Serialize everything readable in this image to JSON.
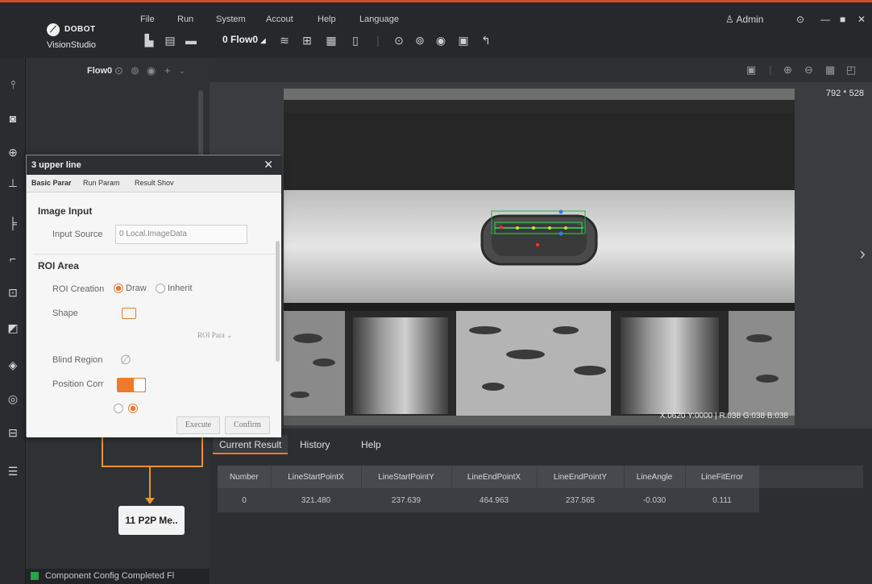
{
  "brand": {
    "logo": "DOBOT",
    "app_name": "VisionStudio"
  },
  "menu": [
    "File",
    "Run",
    "System",
    "Accout",
    "Help",
    "Language"
  ],
  "user": {
    "name": "Admin"
  },
  "toolbar": {
    "flow_select": "0 Flow0"
  },
  "flow_panel": {
    "title": "Flow0",
    "node_label": "11 P2P Me..",
    "status": "Component Config Completed Fl"
  },
  "viewer": {
    "image_size": "792 * 528",
    "pixel_info": "X:0620 Y:0000 | R:038 G:038 B:038"
  },
  "results": {
    "tabs": [
      "Current Result",
      "History",
      "Help"
    ],
    "columns": [
      "Number",
      "LineStartPointX",
      "LineStartPointY",
      "LineEndPointX",
      "LineEndPointY",
      "LineAngle",
      "LineFitError"
    ],
    "rows": [
      [
        "0",
        "321.480",
        "237.639",
        "464.963",
        "237.565",
        "-0.030",
        "0.111"
      ]
    ]
  },
  "dialog": {
    "title": "3 upper line",
    "tabs": [
      "Basic Parar",
      "Run Param",
      "Result Shov"
    ],
    "image_input_title": "Image Input",
    "input_source_label": "Input Source",
    "input_source_value": "0 Local.ImageData",
    "roi_area_title": "ROI Area",
    "roi_creation_label": "ROI Creation",
    "roi_option_draw": "Draw",
    "roi_option_inherit": "Inherit",
    "shape_label": "Shape",
    "roi_param": "ROI Para",
    "blind_region_label": "Blind Region",
    "position_corr_label": "Position Corr",
    "execute": "Execute",
    "confirm": "Confirm"
  },
  "colors": {
    "accent": "#ee7a2c",
    "title_bar": "#26282b",
    "ok": "#26a644"
  }
}
